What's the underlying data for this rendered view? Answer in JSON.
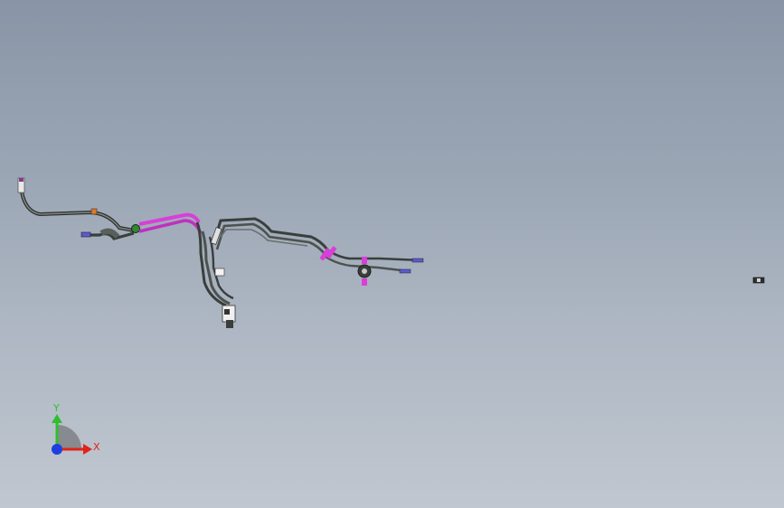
{
  "triad": {
    "x_label": "X",
    "y_label": "Y",
    "x_color": "#e2231a",
    "y_color": "#2fbf2f",
    "z_color": "#1f3fe0"
  },
  "colors": {
    "tube": "#3a3f3c",
    "tube_highlight": "#9aa09c",
    "hose_magenta": "#d83fd8",
    "fitting_blue": "#5a5ad0",
    "fitting_orange": "#e07a20",
    "fitting_green": "#2e8a2e"
  }
}
